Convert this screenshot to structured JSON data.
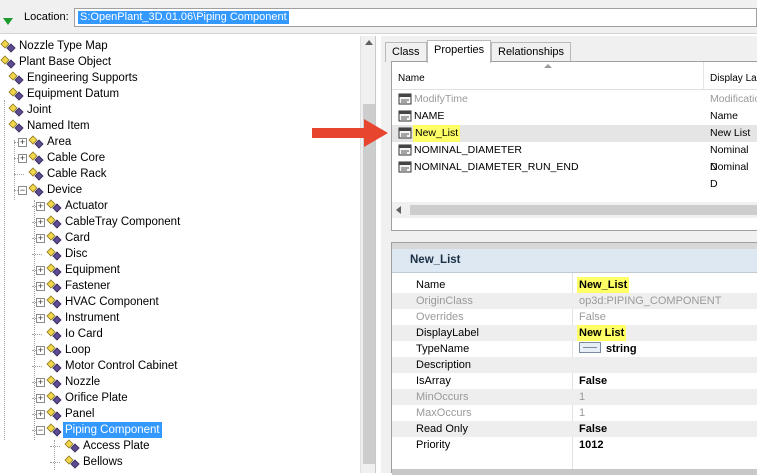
{
  "location": {
    "label": "Location:",
    "value": "S:OpenPlant_3D.01.06\\Piping Component"
  },
  "tree": [
    {
      "label": "Nozzle Type Map",
      "level": 0,
      "expander": "",
      "selected": false
    },
    {
      "label": "Plant Base Object",
      "level": 0,
      "expander": "",
      "selected": false
    },
    {
      "label": "Engineering Supports",
      "level": 1,
      "expander": "",
      "selected": false
    },
    {
      "label": "Equipment Datum",
      "level": 1,
      "expander": "",
      "selected": false
    },
    {
      "label": "Joint",
      "level": 1,
      "expander": "",
      "selected": false
    },
    {
      "label": "Named Item",
      "level": 1,
      "expander": "",
      "selected": false
    },
    {
      "label": "Area",
      "level": 2,
      "expander": "+",
      "selected": false
    },
    {
      "label": "Cable Core",
      "level": 2,
      "expander": "+",
      "selected": false
    },
    {
      "label": "Cable Rack",
      "level": 2,
      "expander": "",
      "selected": false
    },
    {
      "label": "Device",
      "level": 2,
      "expander": "-",
      "selected": false
    },
    {
      "label": "Actuator",
      "level": 3,
      "expander": "+",
      "selected": false
    },
    {
      "label": "CableTray Component",
      "level": 3,
      "expander": "+",
      "selected": false
    },
    {
      "label": "Card",
      "level": 3,
      "expander": "+",
      "selected": false
    },
    {
      "label": "Disc",
      "level": 3,
      "expander": "",
      "selected": false
    },
    {
      "label": "Equipment",
      "level": 3,
      "expander": "+",
      "selected": false
    },
    {
      "label": "Fastener",
      "level": 3,
      "expander": "+",
      "selected": false
    },
    {
      "label": "HVAC Component",
      "level": 3,
      "expander": "+",
      "selected": false
    },
    {
      "label": "Instrument",
      "level": 3,
      "expander": "+",
      "selected": false
    },
    {
      "label": "Io Card",
      "level": 3,
      "expander": "",
      "selected": false
    },
    {
      "label": "Loop",
      "level": 3,
      "expander": "+",
      "selected": false
    },
    {
      "label": "Motor Control Cabinet",
      "level": 3,
      "expander": "",
      "selected": false
    },
    {
      "label": "Nozzle",
      "level": 3,
      "expander": "+",
      "selected": false
    },
    {
      "label": "Orifice Plate",
      "level": 3,
      "expander": "+",
      "selected": false
    },
    {
      "label": "Panel",
      "level": 3,
      "expander": "+",
      "selected": false
    },
    {
      "label": "Piping Component",
      "level": 3,
      "expander": "-",
      "selected": true
    },
    {
      "label": "Access Plate",
      "level": 4,
      "expander": "",
      "selected": false
    },
    {
      "label": "Bellows",
      "level": 4,
      "expander": "",
      "selected": false
    }
  ],
  "tabs": [
    {
      "label": "Class",
      "active": false
    },
    {
      "label": "Properties",
      "active": true
    },
    {
      "label": "Relationships",
      "active": false
    }
  ],
  "grid": {
    "col_name": "Name",
    "col_display": "Display La",
    "rows": [
      {
        "name": "ModifyTime",
        "display": "Modificatio",
        "grey": true,
        "highlight": false,
        "selected": false
      },
      {
        "name": "NAME",
        "display": "Name",
        "grey": false,
        "highlight": false,
        "selected": false
      },
      {
        "name": "New_List",
        "display": "New List",
        "grey": false,
        "highlight": true,
        "selected": true
      },
      {
        "name": "NOMINAL_DIAMETER",
        "display": "Nominal D",
        "grey": false,
        "highlight": false,
        "selected": false
      },
      {
        "name": "NOMINAL_DIAMETER_RUN_END",
        "display": "Nominal D",
        "grey": false,
        "highlight": false,
        "selected": false
      }
    ]
  },
  "detail": {
    "title": "New_List",
    "rows": [
      {
        "key": "Name",
        "value": "New_List",
        "keyGrey": false,
        "valGrey": false,
        "highlight": true,
        "icon": false
      },
      {
        "key": "OriginClass",
        "value": "op3d:PIPING_COMPONENT",
        "keyGrey": true,
        "valGrey": true,
        "highlight": false,
        "icon": false
      },
      {
        "key": "Overrides",
        "value": "False",
        "keyGrey": true,
        "valGrey": true,
        "highlight": false,
        "icon": false
      },
      {
        "key": "DisplayLabel",
        "value": "New List",
        "keyGrey": false,
        "valGrey": false,
        "highlight": true,
        "icon": false
      },
      {
        "key": "TypeName",
        "value": "string",
        "keyGrey": false,
        "valGrey": false,
        "highlight": false,
        "icon": true
      },
      {
        "key": "Description",
        "value": "",
        "keyGrey": false,
        "valGrey": false,
        "highlight": false,
        "icon": false
      },
      {
        "key": "IsArray",
        "value": "False",
        "keyGrey": false,
        "valGrey": false,
        "highlight": false,
        "icon": false
      },
      {
        "key": "MinOccurs",
        "value": "1",
        "keyGrey": true,
        "valGrey": true,
        "highlight": false,
        "icon": false
      },
      {
        "key": "MaxOccurs",
        "value": "1",
        "keyGrey": true,
        "valGrey": true,
        "highlight": false,
        "icon": false
      },
      {
        "key": "Read Only",
        "value": "False",
        "keyGrey": false,
        "valGrey": false,
        "highlight": false,
        "icon": false
      },
      {
        "key": "Priority",
        "value": "1012",
        "keyGrey": false,
        "valGrey": false,
        "highlight": false,
        "icon": false
      }
    ]
  },
  "colors": {
    "selection": "#3399ff",
    "highlight": "#ffff66",
    "arrow": "#e8452f"
  }
}
